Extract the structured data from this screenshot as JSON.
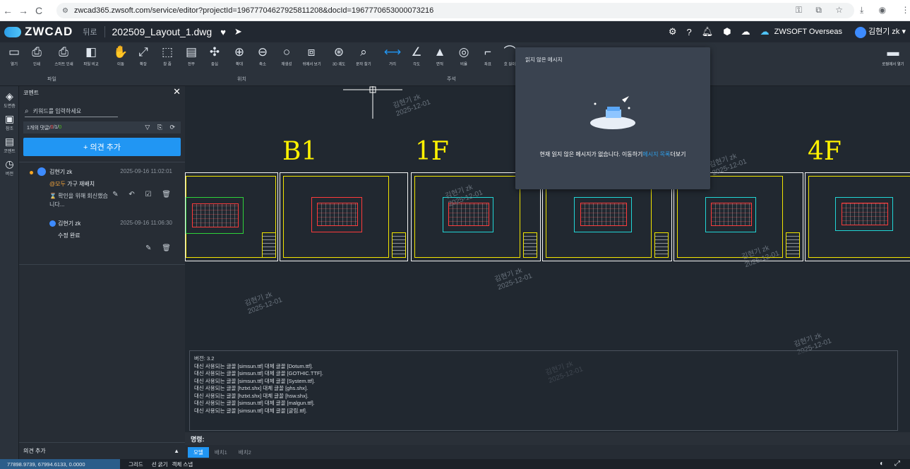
{
  "browser": {
    "url": "zwcad365.zwsoft.com/service/editor?projectId=19677704627925811208&docId=1967770653000073216",
    "nav": [
      "←",
      "→",
      "C"
    ]
  },
  "app": {
    "brand": "ZWCAD",
    "back_label": "뒤로",
    "file_name": "202509_Layout_1.dwg",
    "org": "ZWSOFT Overseas",
    "user": "김현기 zk ▾"
  },
  "ribbon": {
    "groups": [
      "파일",
      "위치",
      "주석"
    ],
    "buttons": [
      "열기",
      "인쇄",
      "스마트 인쇄",
      "파일 비교",
      "이동",
      "확장",
      "창 줌",
      "전부",
      "중심",
      "확대",
      "축소",
      "재생성",
      "위에서 보기",
      "3D 궤도",
      "문자 찾기",
      "거리",
      "각도",
      "면적",
      "비율",
      "좌표",
      "호 길이"
    ],
    "open_local": "로컬에서 열기"
  },
  "leftbar": [
    "도면층",
    "참조",
    "코멘트",
    "버전"
  ],
  "comments": {
    "title": "코멘트",
    "search_placeholder": "키워드를 입력하세요",
    "count_prefix": "1개의 댓글/",
    "count_red": "0",
    "count_mid": "/1/",
    "count_green": "0",
    "add_button": "+ 의견 추가",
    "items": [
      {
        "name": "김현기 zk",
        "time": "2025-09-16 11:02:01",
        "mention": "@모두",
        "text": "가구 재배치",
        "status": "확인을 위해 회신했습니다..."
      }
    ],
    "replies": [
      {
        "name": "김현기 zk",
        "time": "2025-09-16 11:06:30",
        "text": "수정 완료"
      }
    ],
    "footer": "의견 추가"
  },
  "canvas": {
    "floor_labels": [
      "B1",
      "1F",
      "4F"
    ],
    "watermark_name": "김현기 zk",
    "watermark_date": "2025-12-01",
    "console": [
      "버전: 3.2",
      "대신 사용되는 글꼴 [simsun.ttf] 대체 글꼴 [Dotum.ttf].",
      "대신 사용되는 글꼴 [simsun.ttf] 대체 글꼴 [GOTHIC.TTF].",
      "대신 사용되는 글꼴 [simsun.ttf] 대체 글꼴 [System.ttf].",
      "대신 사용되는 글꼴 [hztxt.shx] 대체 글꼴 [ghs.shx].",
      "대신 사용되는 글꼴 [hztxt.shx] 대체 글꼴 [hsw.shx].",
      "대신 사용되는 글꼴 [simsun.ttf] 대체 글꼴 [malgun.ttf].",
      "대신 사용되는 글꼴 [simsun.ttf] 대체 글꼴 [굴림.ttf]."
    ],
    "command_label": "명령:",
    "tabs": [
      "모델",
      "배치1",
      "배치2"
    ]
  },
  "status": {
    "coords": "77898.9739, 67994.6133, 0.0000",
    "toggles": [
      "그리드",
      "선 굵기",
      "객체 스냅"
    ]
  },
  "notifications": {
    "title": "읽지 않은 메시지",
    "message": "현재 읽지 않은 메시지가 없습니다. 이동하기",
    "link": "메시지 목록",
    "suffix": "더보기"
  }
}
